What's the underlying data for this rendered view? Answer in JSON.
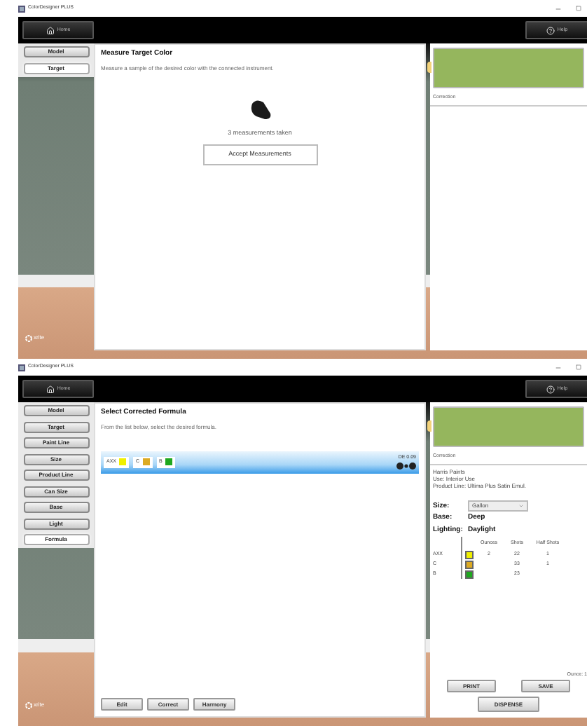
{
  "windows": [
    {
      "title": "ColorDesigner PLUS",
      "home": "Home",
      "help": "Help",
      "logo": "xrite",
      "sidebar": [
        {
          "label": "Model",
          "selected": false
        },
        {
          "label": "Target",
          "selected": true
        }
      ],
      "panel": {
        "kind": "measure",
        "heading": "Measure Target Color",
        "instruction": "Measure a sample of the desired color with the connected instrument.",
        "status": "3 measurements taken",
        "button": "Accept Measurements"
      },
      "details": {
        "caption": "Correction"
      }
    },
    {
      "title": "ColorDesigner PLUS",
      "home": "Home",
      "help": "Help",
      "logo": "xrite",
      "sidebar": [
        {
          "label": "Model",
          "selected": false
        },
        {
          "label": "Target",
          "selected": false
        },
        {
          "label": "Paint Line",
          "selected": false
        },
        {
          "label": "Size",
          "selected": false
        },
        {
          "label": "Product Line",
          "selected": false
        },
        {
          "label": "Can Size",
          "selected": false
        },
        {
          "label": "Base",
          "selected": false
        },
        {
          "label": "Light",
          "selected": false
        },
        {
          "label": "Formula",
          "selected": true
        }
      ],
      "panel": {
        "kind": "formula",
        "heading": "Select Corrected Formula",
        "instruction": "From the list below, select the desired formula.",
        "formulas": [
          {
            "selected": true,
            "de": "DE 0.09",
            "colorants": [
              {
                "name": "AXX",
                "color": "#f0f000"
              },
              {
                "name": "C",
                "color": "#dcaa22"
              },
              {
                "name": "B",
                "color": "#1fa81f"
              }
            ]
          }
        ],
        "buttons": [
          "Edit",
          "Correct",
          "Harmony"
        ]
      },
      "details": {
        "caption": "Correction",
        "info": [
          "Harris Paints",
          "Use: Interior Use",
          "Product Line: Ultima Plus Satin Emul."
        ],
        "size_label": "Size:",
        "size_value": "Gallon",
        "base_label": "Base:",
        "base_value": "Deep",
        "lighting_label": "Lighting:",
        "lighting_value": "Daylight",
        "columns": [
          "Ounces",
          "Shots",
          "Half Shots"
        ],
        "rows": [
          {
            "name": "AXX",
            "color": "#f0f000",
            "ounces": "2",
            "shots": "22",
            "half_shots": "1"
          },
          {
            "name": "C",
            "color": "#dcaa22",
            "shots": "33",
            "half_shots": "1"
          },
          {
            "name": "B",
            "color": "#1fa81f",
            "shots": "23"
          }
        ],
        "unit_note": "Ounce: 1",
        "print": "PRINT",
        "save": "SAVE",
        "dispense": "DISPENSE"
      }
    }
  ]
}
